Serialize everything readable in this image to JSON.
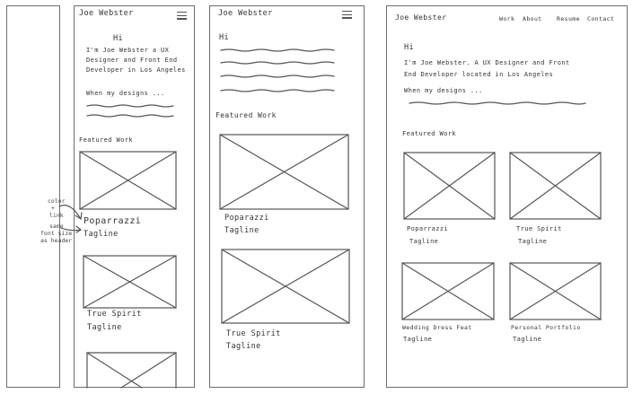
{
  "mobile1": {
    "brand": "Joe Webster",
    "greeting": "Hi",
    "intro_1": "I'm Joe Webster a UX",
    "intro_2": "Designer and Front End",
    "intro_3": "Developer in Los Angeles",
    "designs_lead": "When my designs ...",
    "featured_heading": "Featured Work",
    "projects": [
      {
        "title": "Poparrazzi",
        "tagline": "Tagline"
      },
      {
        "title": "True Spirit",
        "tagline": "Tagline"
      }
    ]
  },
  "annotation": {
    "line1": "color",
    "line2": "+",
    "line3": "link",
    "line4": "same",
    "line5": "font size",
    "line6": "as header"
  },
  "tablet": {
    "brand": "Joe Webster",
    "greeting": "Hi",
    "featured_heading": "Featured Work",
    "projects": [
      {
        "title": "Poparazzi",
        "tagline": "Tagline"
      },
      {
        "title": "True Spirit",
        "tagline": "Tagline"
      }
    ]
  },
  "desktop": {
    "brand": "Joe Webster",
    "nav": [
      "Work",
      "About",
      "Resume",
      "Contact"
    ],
    "greeting": "Hi",
    "intro_1": "I'm Joe Webster. A UX Designer and Front",
    "intro_2": "End Developer located in Los Angeles",
    "designs_lead": "When my designs ...",
    "featured_heading": "Featured Work",
    "projects": [
      {
        "title": "Poparrazzi",
        "tagline": "Tagline"
      },
      {
        "title": "True Spirit",
        "tagline": "Tagline"
      },
      {
        "title": "Wedding Dress Feat",
        "tagline": "Tagline"
      },
      {
        "title": "Personal Portfolio",
        "tagline": "Tagline"
      }
    ]
  }
}
